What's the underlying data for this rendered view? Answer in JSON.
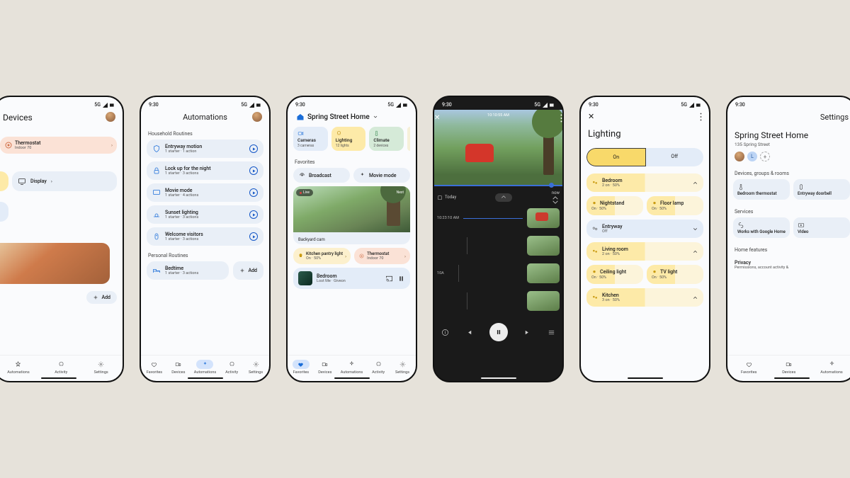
{
  "status": {
    "time": "9:30",
    "network": "5G"
  },
  "nav": {
    "favorites": "Favorites",
    "devices": "Devices",
    "automations": "Automations",
    "activity": "Activity",
    "settings": "Settings"
  },
  "common": {
    "add": "Add"
  },
  "p1": {
    "title": "Devices",
    "thermostat": {
      "label": "Thermostat",
      "sub": "Indoor 70"
    },
    "display": "Display"
  },
  "p2": {
    "title": "Automations",
    "household": "Household Routines",
    "personal": "Personal Routines",
    "items": [
      {
        "title": "Entryway motion",
        "sub": "1 starter · 1 action"
      },
      {
        "title": "Lock up for the night",
        "sub": "1 starter · 3 actions"
      },
      {
        "title": "Movie mode",
        "sub": "1 starter · 4 actions"
      },
      {
        "title": "Sunset lighting",
        "sub": "1 starter · 3 actions"
      },
      {
        "title": "Welcome visitors",
        "sub": "1 starter · 3 actions"
      }
    ],
    "bedtime": {
      "title": "Bedtime",
      "sub": "1 starter · 3 actions"
    }
  },
  "p3": {
    "home": "Spring Street Home",
    "cats": [
      {
        "title": "Cameras",
        "sub": "3 cameras"
      },
      {
        "title": "Lighting",
        "sub": "12 lights"
      },
      {
        "title": "Climate",
        "sub": "2 devices"
      }
    ],
    "favorites": "Favorites",
    "broadcast": "Broadcast",
    "movie": "Movie mode",
    "cam": {
      "label": "Backyard cam",
      "live": "Live",
      "next": "Next"
    },
    "pantry": {
      "title": "Kitchen pantry light",
      "sub": "On · 50%"
    },
    "thermostat": {
      "title": "Thermostat",
      "sub": "Indoor 70"
    },
    "media": {
      "room": "Bedroom",
      "track": "Lost Me · Giveon"
    }
  },
  "p4": {
    "clock": "10:10:55 AM",
    "today": "Today",
    "now": "now",
    "stamp1": "10:23:10 AM",
    "stamp2": "10A"
  },
  "p5": {
    "title": "Lighting",
    "on": "On",
    "off": "Off",
    "rooms": [
      {
        "name": "Bedroom",
        "sub": "2 on · 50%"
      },
      {
        "name": "Entryway",
        "sub": "Off"
      },
      {
        "name": "Living room",
        "sub": "2 on · 50%"
      },
      {
        "name": "Kitchen",
        "sub": "3 on · 50%"
      }
    ],
    "bedroom_lights": [
      {
        "name": "Nightstand",
        "sub": "On · 50%"
      },
      {
        "name": "Floor lamp",
        "sub": "On · 50%"
      }
    ],
    "living_lights": [
      {
        "name": "Ceiling light",
        "sub": "On · 50%"
      },
      {
        "name": "TV light",
        "sub": "On · 50%"
      }
    ]
  },
  "p6": {
    "header": "Settings",
    "home": "Spring Street Home",
    "addr": "135 Spring Street",
    "avatar_initial": "L",
    "sec_devices": "Devices, groups & rooms",
    "d1": "Bedroom thermostat",
    "d2": "Entryway doorbell",
    "sec_services": "Services",
    "s1": "Works with Google Home",
    "s2": "Video",
    "sec_features": "Home features",
    "privacy": {
      "title": "Privacy",
      "sub": "Permissions, account activity &"
    }
  }
}
